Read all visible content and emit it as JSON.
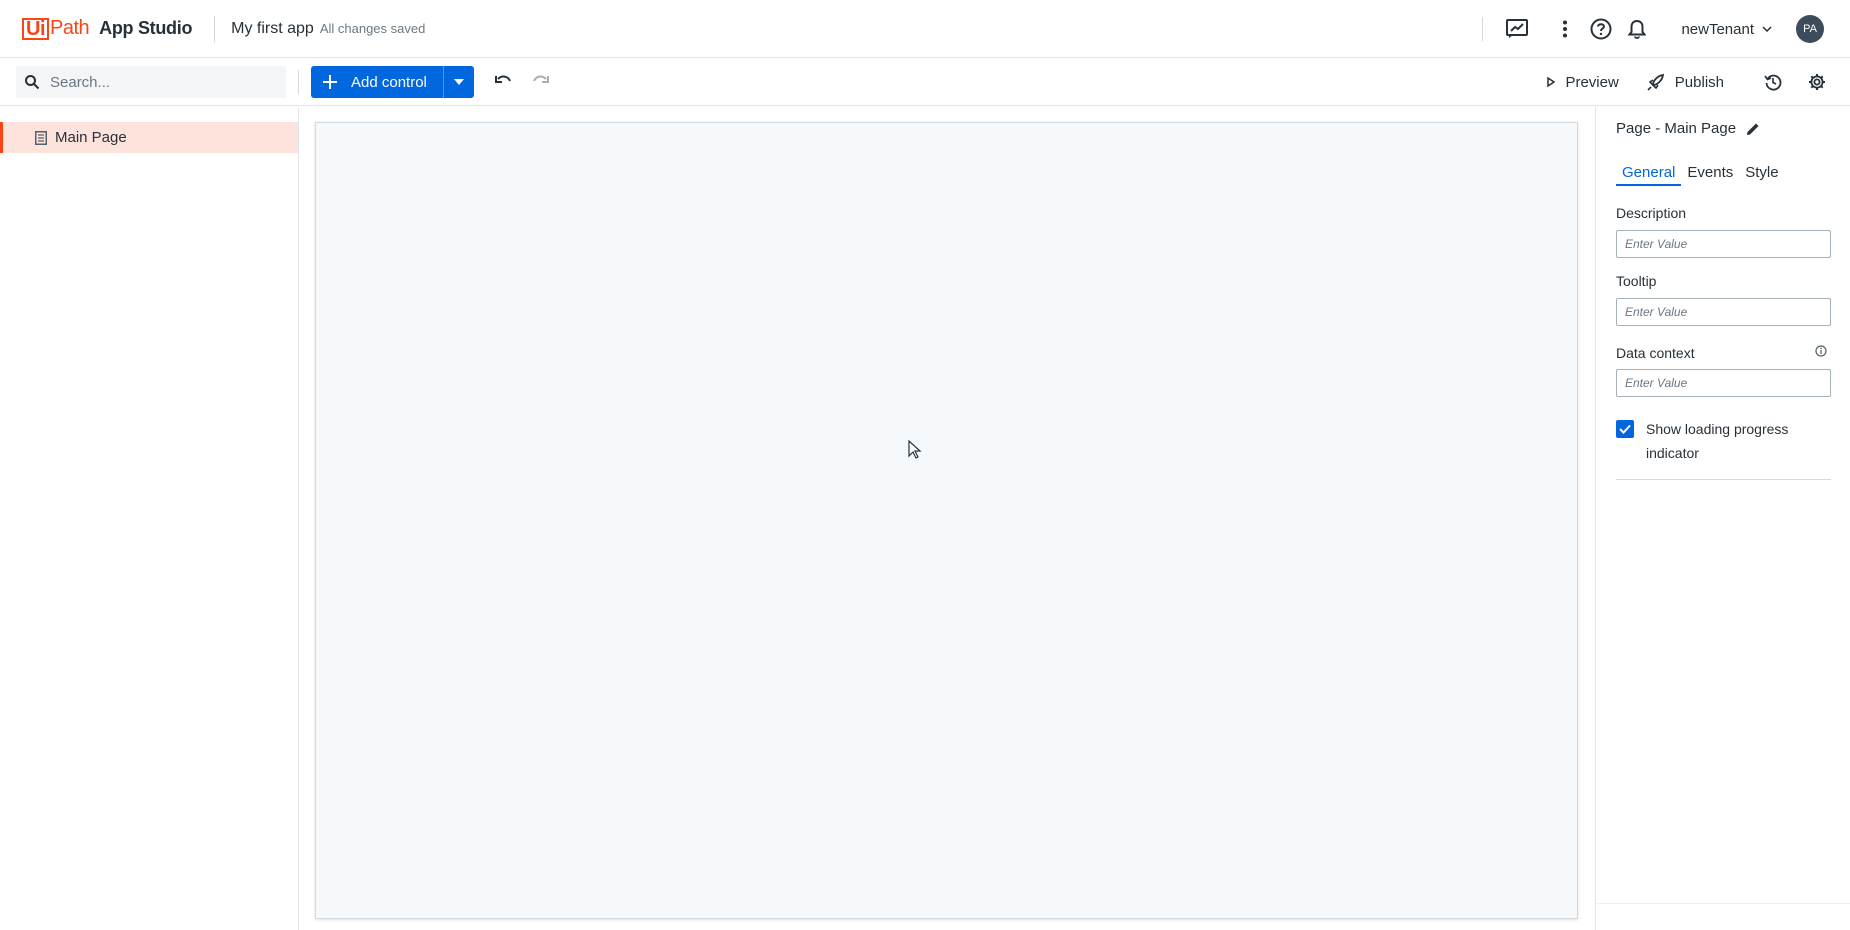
{
  "header": {
    "logo_ui": "Ui",
    "logo_path": "Path",
    "product": "App Studio",
    "app_name": "My first app",
    "save_status": "All changes saved",
    "tenant": "newTenant",
    "avatar_initials": "PA"
  },
  "toolbar": {
    "search_placeholder": "Search...",
    "add_control_label": "Add control",
    "preview_label": "Preview",
    "publish_label": "Publish"
  },
  "tree": {
    "items": [
      {
        "label": "Main Page",
        "selected": true
      }
    ]
  },
  "properties": {
    "title": "Page - Main Page",
    "tabs": [
      {
        "label": "General",
        "active": true
      },
      {
        "label": "Events",
        "active": false
      },
      {
        "label": "Style",
        "active": false
      }
    ],
    "fields": [
      {
        "label": "Description",
        "placeholder": "Enter Value",
        "value": ""
      },
      {
        "label": "Tooltip",
        "placeholder": "Enter Value",
        "value": ""
      },
      {
        "label": "Data context",
        "placeholder": "Enter Value",
        "value": ""
      }
    ],
    "checkbox": {
      "label": "Show loading progress indicator",
      "checked": true
    }
  },
  "colors": {
    "brand": "#fa4616",
    "accent": "#0067df",
    "canvas_bg": "#f5f9fc",
    "selected_row": "#fde3dc"
  },
  "icons": [
    "search-icon",
    "feedback-icon",
    "more-vert-icon",
    "help-icon",
    "bell-icon",
    "chevron-down-icon",
    "plus-icon",
    "undo-icon",
    "redo-icon",
    "play-icon",
    "rocket-icon",
    "history-icon",
    "gear-icon",
    "page-icon",
    "pencil-icon",
    "info-icon",
    "check-icon"
  ]
}
